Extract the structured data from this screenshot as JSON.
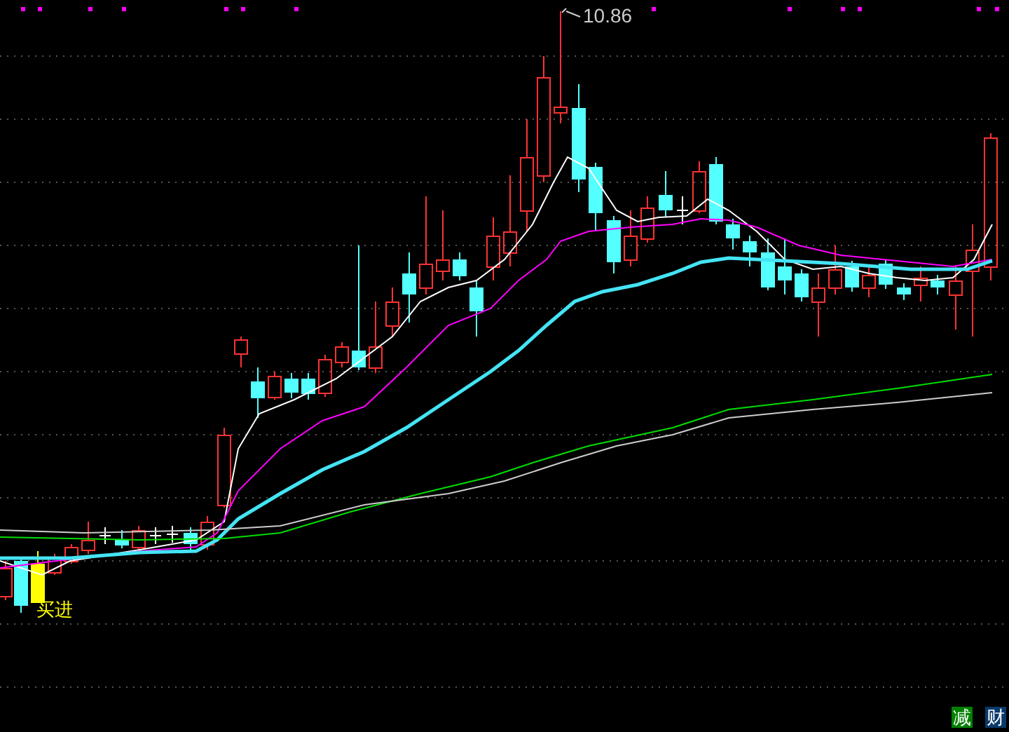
{
  "chart": {
    "high_label": "10.86",
    "signal_label": "买进"
  },
  "badges": [
    {
      "text": "减",
      "color": "#008000"
    },
    {
      "text": "财",
      "color": "#0a3a6a"
    }
  ]
}
